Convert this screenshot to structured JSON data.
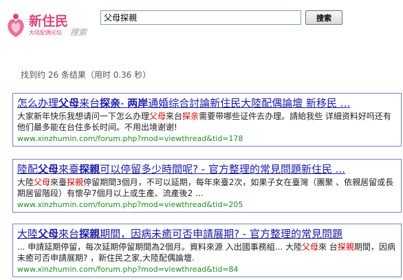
{
  "logo": {
    "title": "新住民",
    "subtitle": "大陆配偶论坛",
    "search_word": "搜索",
    "accent": "#d9467a"
  },
  "search": {
    "query": "父母探親",
    "button_label": "搜索"
  },
  "stats": {
    "text": "找到约 26 条结果（用时 0.36 秒）"
  },
  "results": [
    {
      "title_parts": [
        {
          "text": "怎么办理",
          "hl": false
        },
        {
          "text": "父母",
          "hl": true
        },
        {
          "text": "来台",
          "hl": false
        },
        {
          "text": "探亲",
          "hl": true
        },
        {
          "text": "- ",
          "hl": false
        },
        {
          "text": "两岸",
          "hl": true
        },
        {
          "text": "通婚综合討論新住民大陸配偶論壇 新移民 ...",
          "hl": false
        }
      ],
      "snippet_parts": [
        {
          "text": "大家新年快乐我想请问一下怎么办理",
          "hl": false
        },
        {
          "text": "父母",
          "hl": true
        },
        {
          "text": "来台",
          "hl": false
        },
        {
          "text": "探亲",
          "hl": true
        },
        {
          "text": "需要带哪些证件去办理。請給我些 详細资料好吗还有他们最多能在台住多长时间。不用出境谢谢!",
          "hl": false
        }
      ],
      "url": "www.xinzhumin.com/forum.php?mod=viewthread&tid=178"
    },
    {
      "title_parts": [
        {
          "text": "陸配",
          "hl": false
        },
        {
          "text": "父母",
          "hl": true
        },
        {
          "text": "來臺",
          "hl": false
        },
        {
          "text": "探親",
          "hl": true
        },
        {
          "text": "可以停留多少時間呢? - 官方整理的常見問題新住民 ...",
          "hl": false
        }
      ],
      "snippet_parts": [
        {
          "text": "大陸",
          "hl": false
        },
        {
          "text": "父母",
          "hl": true
        },
        {
          "text": "來臺",
          "hl": false
        },
        {
          "text": "探親",
          "hl": true
        },
        {
          "text": "停留期間3個月，不可以延期，每年來臺2次，如果子女在臺灣（團聚 、依親居留或長期居留階段）有懷孕7個月以上或生產、流產後2 ...",
          "hl": false
        }
      ],
      "url": "www.xinzhumin.com/forum.php?mod=viewthread&tid=205"
    },
    {
      "title_parts": [
        {
          "text": "大陸",
          "hl": false
        },
        {
          "text": "父母",
          "hl": true
        },
        {
          "text": "來台",
          "hl": false
        },
        {
          "text": "探親",
          "hl": true
        },
        {
          "text": "期間，因病未癒可否申請展期? - 官方整理的常見問題",
          "hl": false
        }
      ],
      "snippet_parts": [
        {
          "text": "... 申請延期停留，每次延期停留期間為2個月。資料來源 入出國事務組... 大陸",
          "hl": false
        },
        {
          "text": "父母",
          "hl": true
        },
        {
          "text": "來 台",
          "hl": false
        },
        {
          "text": "探親",
          "hl": true
        },
        {
          "text": "期間，因病未癒可否申請展期? ，新住民之家,大陸配偶論壇.",
          "hl": false
        }
      ],
      "url": "www.xinzhumin.com/forum.php?mod=viewthread&tid=84"
    }
  ]
}
